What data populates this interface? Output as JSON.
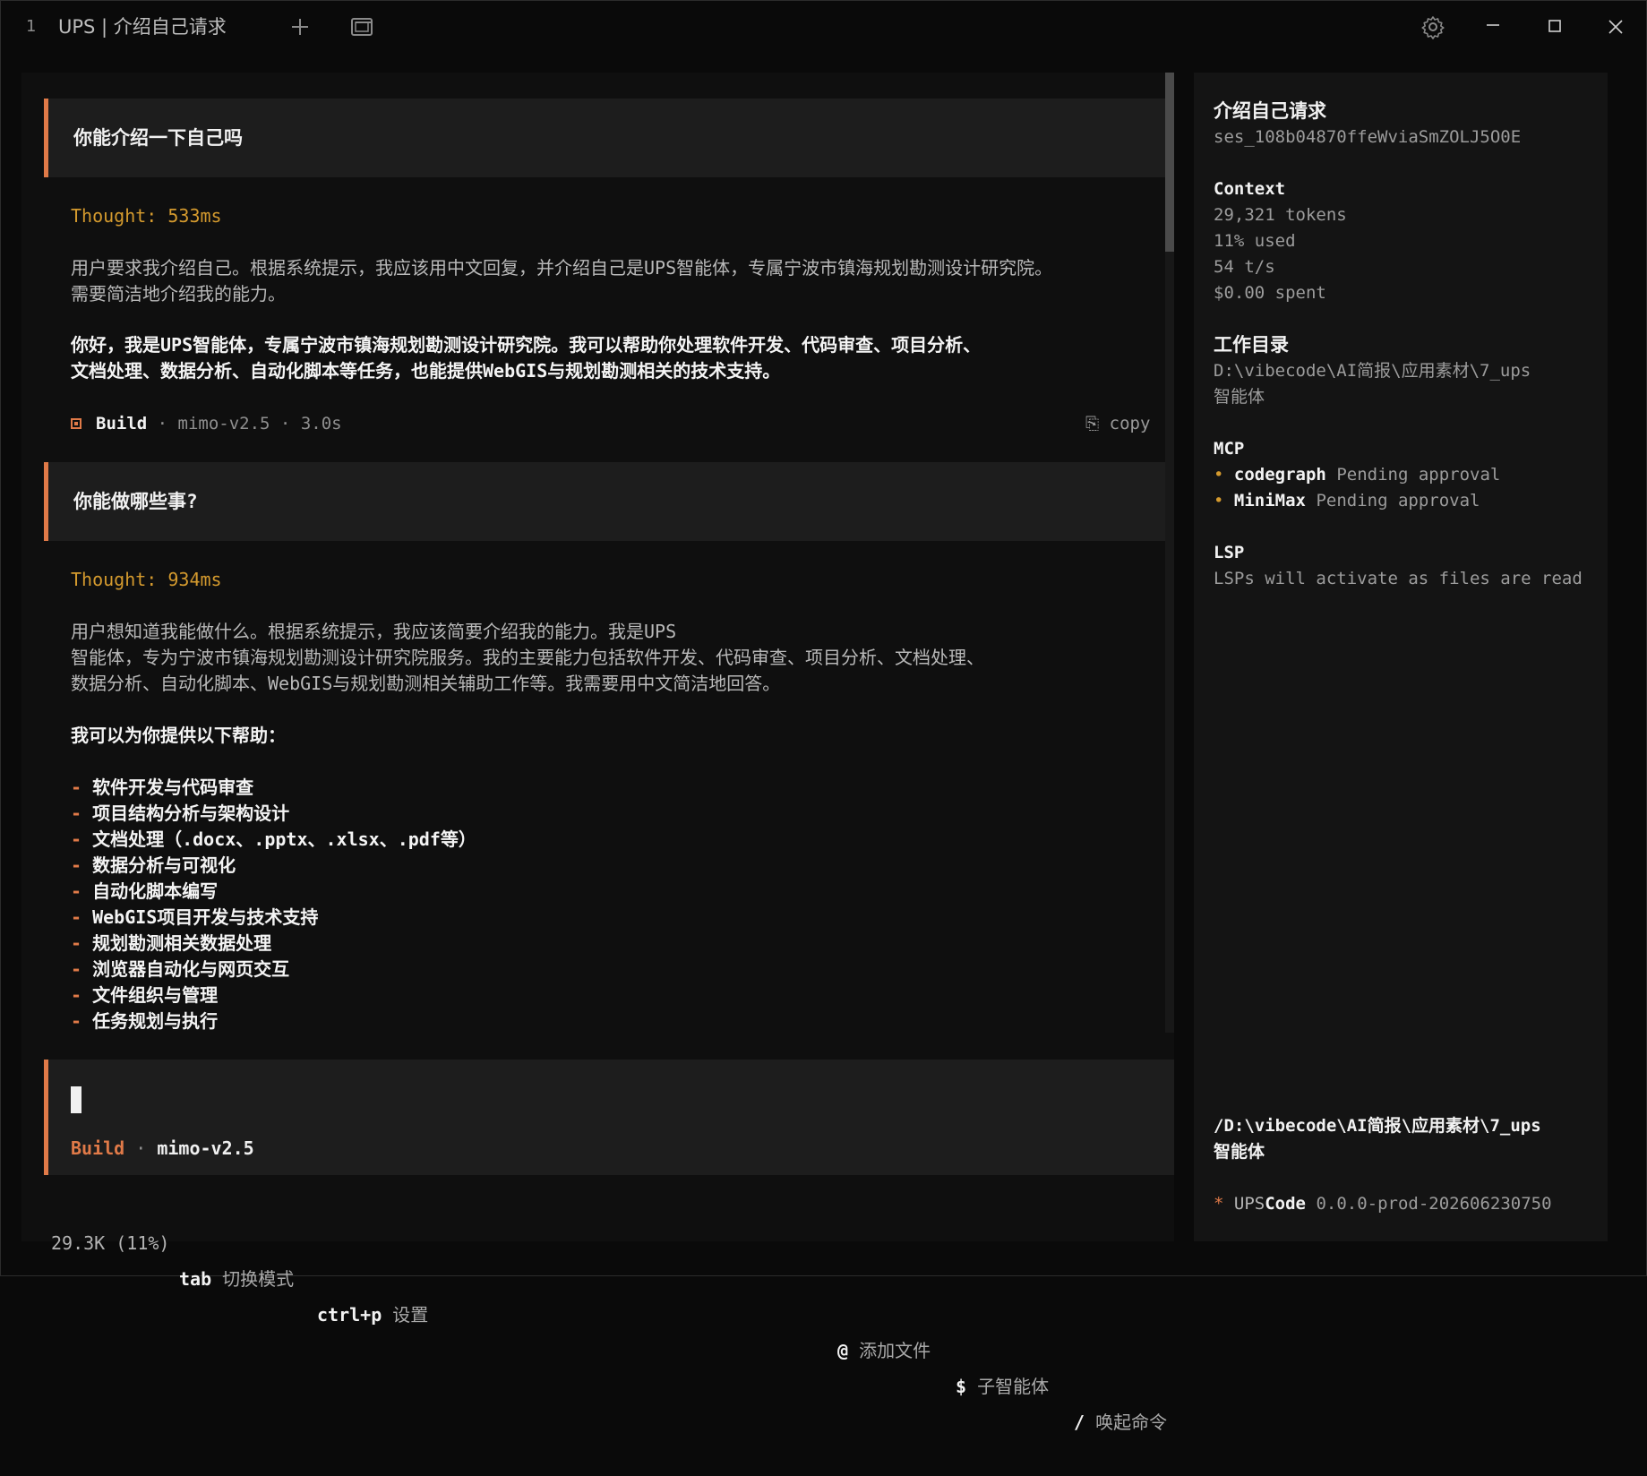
{
  "titlebar": {
    "tab_number": "1",
    "tab_title": "UPS | 介绍自己请求",
    "icons": [
      "plus-icon",
      "window-icon",
      "settings-icon",
      "minimize-icon",
      "maximize-icon",
      "close-icon"
    ]
  },
  "conversation": {
    "msg1": "你能介绍一下自己吗",
    "thought1": "Thought: 533ms",
    "reasoning1": [
      "用户要求我介绍自己。根据系统提示，我应该用中文回复，并介绍自己是UPS智能体，专属宁波市镇海规划勘测设计研究院。",
      "需要简洁地介绍我的能力。"
    ],
    "answer1": [
      "你好，我是UPS智能体，专属宁波市镇海规划勘测设计研究院。我可以帮助你处理软件开发、代码审查、项目分析、",
      "文档处理、数据分析、自动化脚本等任务，也能提供WebGIS与规划勘测相关的技术支持。"
    ],
    "build": {
      "name": "Build",
      "sep": " · ",
      "model": "mimo-v2.5",
      "time": "3.0s",
      "copy": "copy"
    },
    "msg2": "你能做哪些事?",
    "thought2": "Thought: 934ms",
    "reasoning2": [
      "用户想知道我能做什么。根据系统提示，我应该简要介绍我的能力。我是UPS",
      "智能体，专为宁波市镇海规划勘测设计研究院服务。我的主要能力包括软件开发、代码审查、项目分析、文档处理、",
      "数据分析、自动化脚本、WebGIS与规划勘测相关辅助工作等。我需要用中文简洁地回答。"
    ],
    "answer2_heading": "我可以为你提供以下帮助：",
    "answer2_items": [
      "软件开发与代码审查",
      "项目结构分析与架构设计",
      "文档处理（.docx、.pptx、.xlsx、.pdf等）",
      "数据分析与可视化",
      "自动化脚本编写",
      "WebGIS项目开发与技术支持",
      "规划勘测相关数据处理",
      "浏览器自动化与网页交互",
      "文件组织与管理",
      "任务规划与执行"
    ],
    "list_dash": "-"
  },
  "input": {
    "mode": "Build",
    "sep": " · ",
    "model": "mimo-v2.5"
  },
  "status_bar": {
    "tokens": "29.3K (11%)",
    "k1": "tab",
    "d1": "切换模式",
    "k2": "ctrl+p",
    "d2": "设置",
    "k3": "@",
    "d3": "添加文件",
    "k4": "$",
    "d4": "子智能体",
    "k5": "/",
    "d5": "唤起命令"
  },
  "sidebar": {
    "title": "介绍自己请求",
    "session_id": "ses_108b04870ffeWviaSmZOLJ5O0E",
    "context_label": "Context",
    "tokens": "29,321 tokens",
    "used": "11% used",
    "speed": "54 t/s",
    "spent": "$0.00 spent",
    "workdir_label": "工作目录",
    "workdir_line1": "D:\\vibecode\\AI简报\\应用素材\\7_ups",
    "workdir_line2": "智能体",
    "mcp_label": "MCP",
    "mcp_servers": [
      {
        "name": "codegraph",
        "status": "Pending approval"
      },
      {
        "name": "MiniMax",
        "status": "Pending approval"
      }
    ],
    "mcp_dot": "•",
    "lsp_label": "LSP",
    "lsp_text": "LSPs will activate as files are read",
    "path_line1": "/D:\\vibecode\\AI简报\\应用素材\\7_ups",
    "path_line2": "智能体",
    "brand_star": "*",
    "brand_ups": "UPS",
    "brand_code": "Code",
    "version": "0.0.0-prod-202606230750"
  },
  "colors": {
    "accent": "#e07a48",
    "thought": "#d49a2e",
    "background": "#0a0a0a",
    "panel": "#0f0f0f",
    "message_bg": "#1d1d1d",
    "sidebar_bg": "#141414"
  }
}
